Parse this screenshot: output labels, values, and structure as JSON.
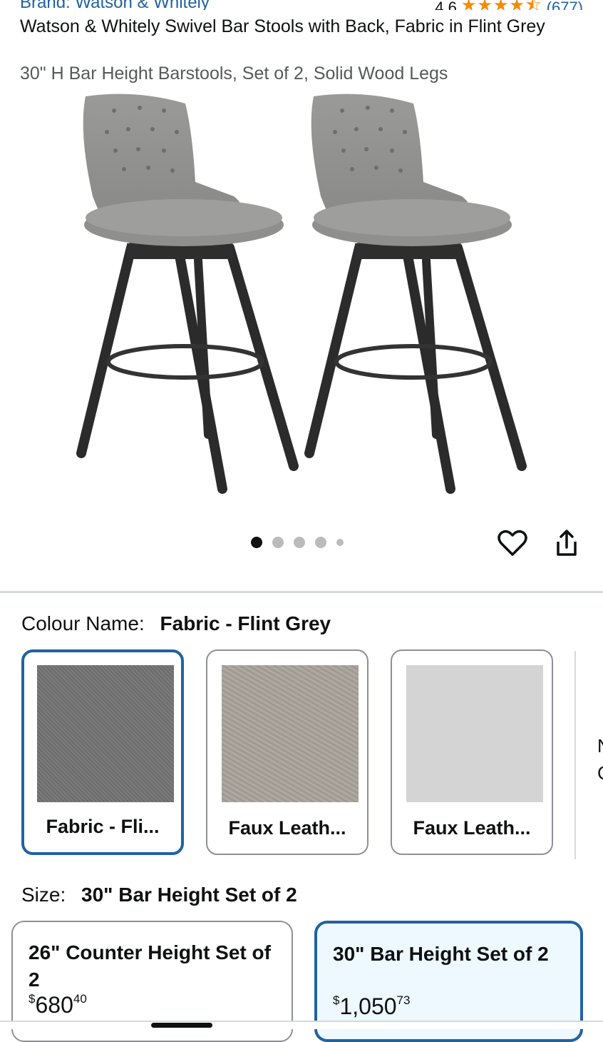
{
  "header": {
    "brand": "Brand: Watson & Whitely",
    "rating_value": "4.6",
    "rating_stars": "★★★★⯪",
    "rating_count": "(677)",
    "title": "Watson & Whitely Swivel Bar Stools with Back, Fabric in Flint Grey",
    "subtitle": "30\" H Bar Height Barstools, Set of 2, Solid Wood Legs"
  },
  "gallery": {
    "image_count": 5,
    "active_index": 0,
    "favorite_icon": "heart-outline-icon",
    "share_icon": "share-icon"
  },
  "colour": {
    "label": "Colour Name:",
    "selected": "Fabric - Flint Grey",
    "options": [
      {
        "label": "Fabric - Fli...",
        "swatch": "#737373",
        "selected": true
      },
      {
        "label": "Faux Leath...",
        "swatch": "#a8a29a",
        "selected": false
      },
      {
        "label": "Faux Leath...",
        "swatch": "#d4d4d4",
        "selected": false
      }
    ],
    "peek_text": "N\nC"
  },
  "size": {
    "label": "Size:",
    "selected": "30\" Bar Height Set of 2",
    "options": [
      {
        "name": "26\" Counter Height Set of 2",
        "currency": "$",
        "price_whole": "680",
        "price_fraction": "40",
        "selected": false
      },
      {
        "name": "30\" Bar Height Set of 2",
        "currency": "$",
        "price_whole": "1,050",
        "price_fraction": "73",
        "selected": true
      }
    ]
  },
  "colors": {
    "link": "#2162a1",
    "star": "#f58a07",
    "selected_border": "#2162a1",
    "selected_bg": "#edf8ff"
  }
}
